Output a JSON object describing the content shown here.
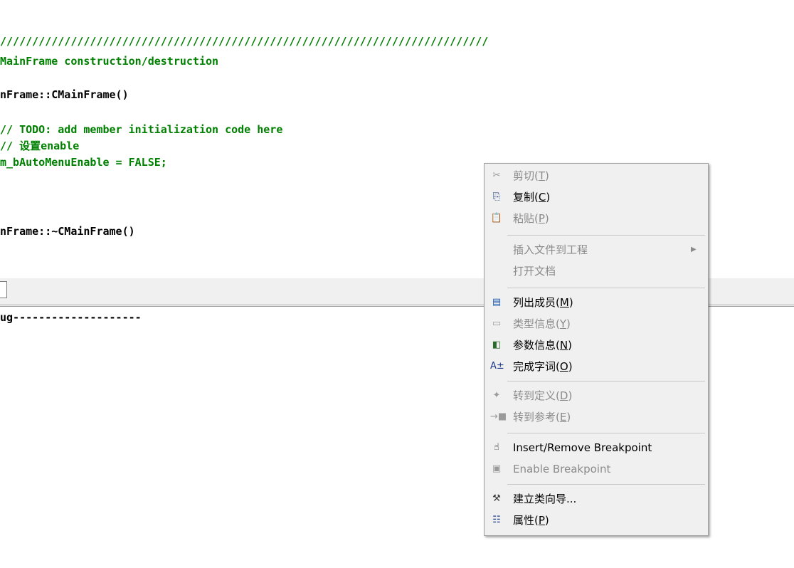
{
  "editor": {
    "lines": [
      {
        "text": "////////////////////////////////////////////////////////////////////////////",
        "color": "green"
      },
      {
        "text": "MainFrame construction/destruction",
        "color": "green"
      },
      {
        "text": "nFrame::CMainFrame()",
        "color": "black"
      },
      {
        "text": "// TODO: add member initialization code here",
        "color": "green"
      },
      {
        "text": "// 设置enable",
        "color": "green"
      },
      {
        "text": "m_bAutoMenuEnable = FALSE;",
        "color": "green"
      },
      {
        "text": "nFrame::~CMainFrame()",
        "color": "black"
      }
    ]
  },
  "output": {
    "first_line": "ug--------------------"
  },
  "context_menu": {
    "items": [
      {
        "icon": "cut-icon",
        "glyph": "✂",
        "label": "剪切",
        "key": "T",
        "enabled": false
      },
      {
        "icon": "copy-icon",
        "glyph": "⎘",
        "label": "复制",
        "key": "C",
        "enabled": true
      },
      {
        "icon": "paste-icon",
        "glyph": "📋",
        "label": "粘贴",
        "key": "P",
        "enabled": false
      },
      {
        "icon": "",
        "glyph": "",
        "label": "插入文件到工程",
        "key": "",
        "enabled": false,
        "submenu": true
      },
      {
        "icon": "",
        "glyph": "",
        "label": "打开文档",
        "key": "",
        "enabled": false
      },
      {
        "icon": "list-members-icon",
        "glyph": "▤",
        "label": "列出成员",
        "key": "M",
        "enabled": true
      },
      {
        "icon": "type-info-icon",
        "glyph": "▭",
        "label": "类型信息",
        "key": "Y",
        "enabled": false
      },
      {
        "icon": "parameter-info-icon",
        "glyph": "◧",
        "label": "参数信息",
        "key": "N",
        "enabled": true
      },
      {
        "icon": "complete-word-icon",
        "glyph": "A±",
        "label": "完成字词",
        "key": "O",
        "enabled": true
      },
      {
        "icon": "goto-definition-icon",
        "glyph": "✦",
        "label": "转到定义",
        "key": "D",
        "enabled": false
      },
      {
        "icon": "goto-reference-icon",
        "glyph": "→■",
        "label": "转到参考",
        "key": "E",
        "enabled": false
      },
      {
        "icon": "hand-icon",
        "glyph": "☝",
        "label": "Insert/Remove Breakpoint",
        "key": "",
        "enabled": true
      },
      {
        "icon": "enable-breakpoint-icon",
        "glyph": "▣",
        "label": "Enable Breakpoint",
        "key": "",
        "enabled": false
      },
      {
        "icon": "class-wizard-icon",
        "glyph": "⚒",
        "label": "建立类向导...",
        "key": "",
        "enabled": true
      },
      {
        "icon": "properties-icon",
        "glyph": "☷",
        "label": "属性",
        "key": "P",
        "enabled": true
      }
    ]
  }
}
